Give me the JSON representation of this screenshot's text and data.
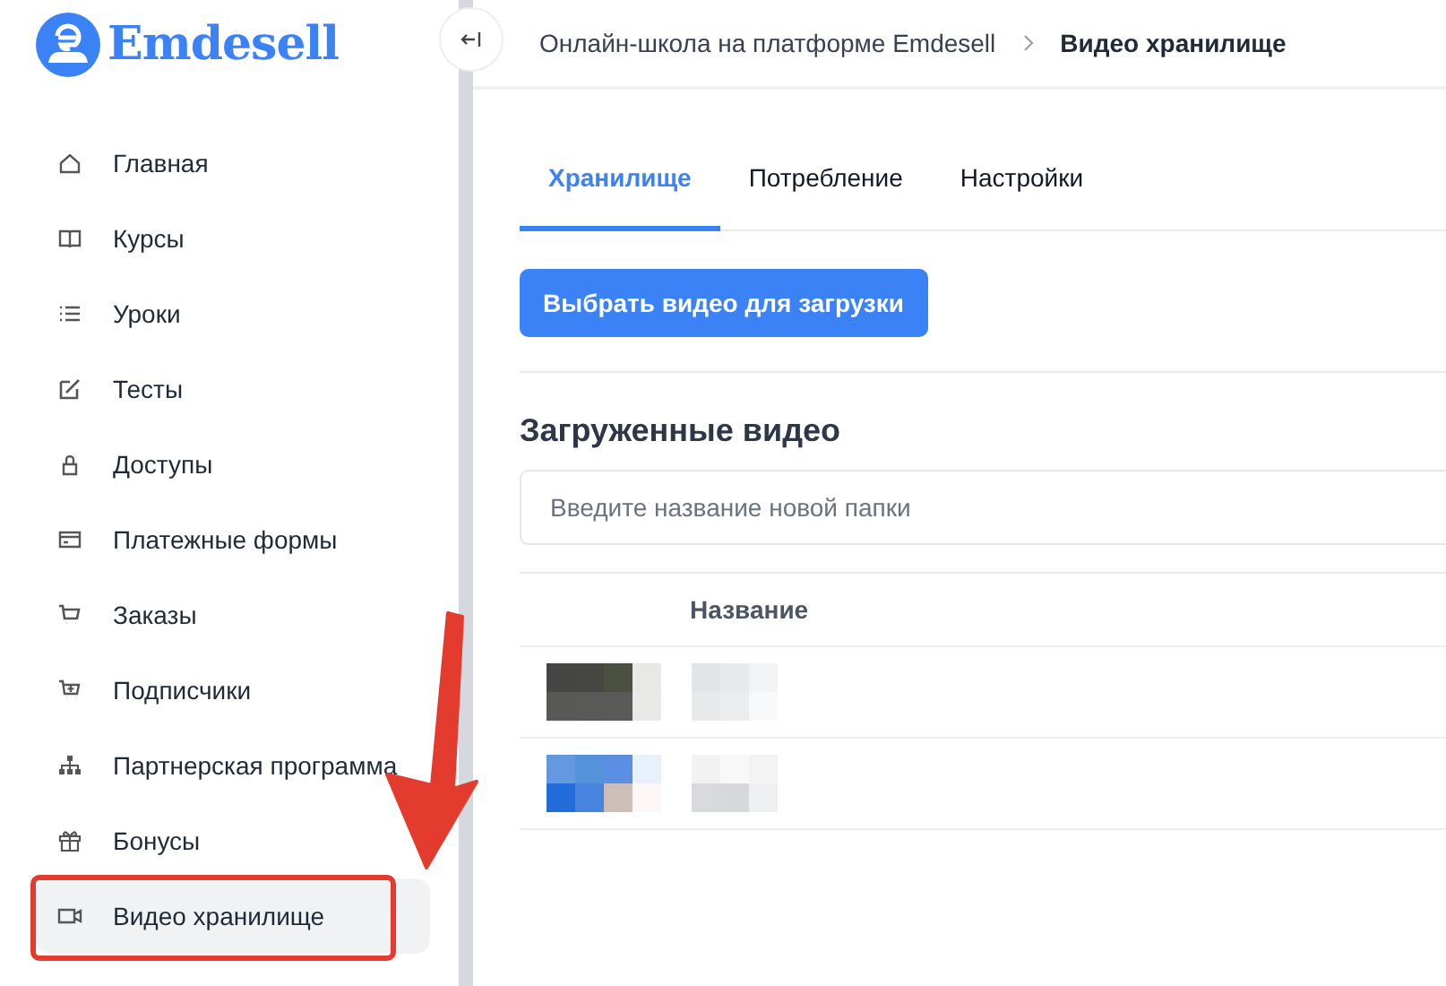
{
  "logo": {
    "text": "Emdesell"
  },
  "sidebar": {
    "items": [
      {
        "label": "Главная",
        "selected": false,
        "highlighted": false
      },
      {
        "label": "Курсы",
        "selected": false,
        "highlighted": false
      },
      {
        "label": "Уроки",
        "selected": false,
        "highlighted": false
      },
      {
        "label": "Тесты",
        "selected": false,
        "highlighted": false
      },
      {
        "label": "Доступы",
        "selected": false,
        "highlighted": false
      },
      {
        "label": "Платежные формы",
        "selected": false,
        "highlighted": false
      },
      {
        "label": "Заказы",
        "selected": false,
        "highlighted": false
      },
      {
        "label": "Подписчики",
        "selected": false,
        "highlighted": false
      },
      {
        "label": "Партнерская программа",
        "selected": false,
        "highlighted": false
      },
      {
        "label": "Бонусы",
        "selected": false,
        "highlighted": false
      },
      {
        "label": "Видео хранилище",
        "selected": true,
        "highlighted": true
      }
    ]
  },
  "breadcrumb": [
    "Онлайн-школа на платформе Emdesell",
    "Видео хранилище"
  ],
  "tabs": [
    {
      "label": "Хранилище",
      "selected": true
    },
    {
      "label": "Потребление",
      "selected": false
    },
    {
      "label": "Настройки",
      "selected": false
    }
  ],
  "upload_button": "Выбрать видео для загрузки",
  "section_title": "Загруженные видео",
  "folder_field": {
    "placeholder": "Введите название новой папки"
  },
  "table": {
    "columns": [
      "Название"
    ],
    "rows": [
      {
        "kind": "blurred"
      },
      {
        "kind": "blurred"
      }
    ]
  }
}
